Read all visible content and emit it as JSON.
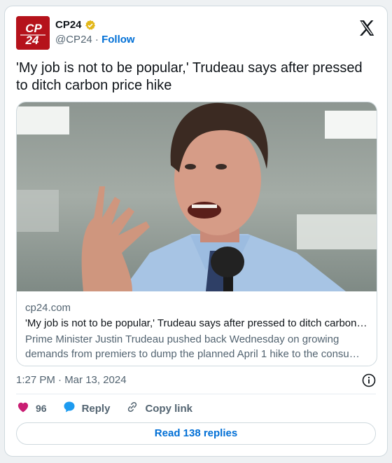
{
  "account": {
    "display_name": "CP24",
    "handle": "@CP24",
    "separator": "·",
    "follow_label": "Follow",
    "avatar_text_top": "CP",
    "avatar_text_bottom": "24",
    "avatar_color": "#b5121b",
    "verified_badge_color": "#e2b719"
  },
  "tweet": {
    "text": "'My job is not to be popular,' Trudeau says after pressed to ditch carbon price hike"
  },
  "link_card": {
    "image_icon": "photo-of-speaker",
    "domain": "cp24.com",
    "title": "'My job is not to be popular,' Trudeau says after pressed to ditch carbon price hike",
    "description": "Prime Minister Justin Trudeau pushed back Wednesday on growing demands from premiers to dump the planned April 1 hike to the consumer carbon price."
  },
  "meta": {
    "timestamp": "1:27 PM · Mar 13, 2024"
  },
  "actions": {
    "like_count": "96",
    "reply_label": "Reply",
    "copy_link_label": "Copy link",
    "read_replies_label": "Read 138 replies"
  },
  "colors": {
    "like": "#f91880",
    "reply": "#1d9bf0",
    "link": "#006fd6",
    "muted": "#536471"
  }
}
